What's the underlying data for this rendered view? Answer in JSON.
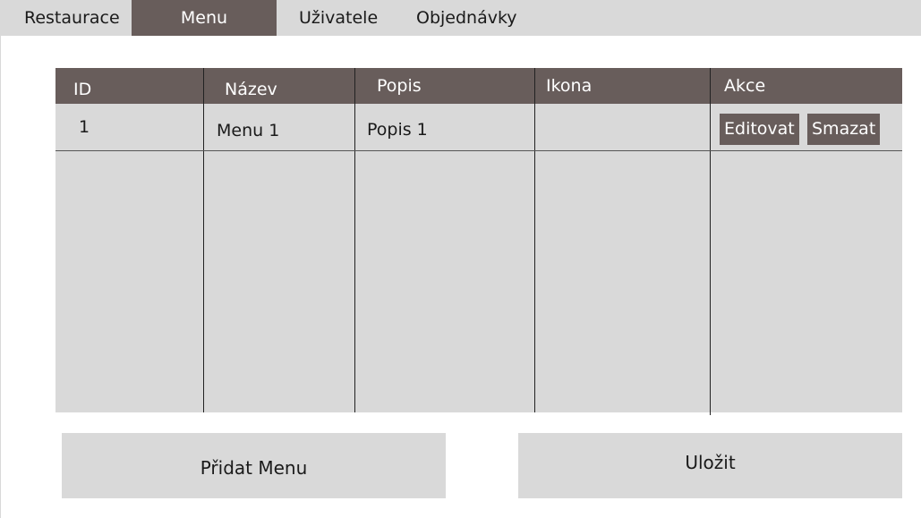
{
  "nav": {
    "items": [
      {
        "label": "Restaurace",
        "active": false
      },
      {
        "label": "Menu",
        "active": true
      },
      {
        "label": "Uživatele",
        "active": false
      },
      {
        "label": "Objednávky",
        "active": false
      }
    ]
  },
  "table": {
    "headers": [
      "ID",
      "Název",
      "Popis",
      "Ikona",
      "Akce"
    ],
    "rows": [
      {
        "id": "1",
        "name": "Menu 1",
        "description": "Popis 1",
        "icon": "",
        "actions": [
          "Editovat",
          "Smazat"
        ]
      }
    ]
  },
  "buttons": {
    "add_label": "Přidat Menu",
    "save_label": "Uložit"
  },
  "colors": {
    "accent": "#685d5b",
    "panel": "#d9d9d9",
    "background": "#ffffff"
  }
}
